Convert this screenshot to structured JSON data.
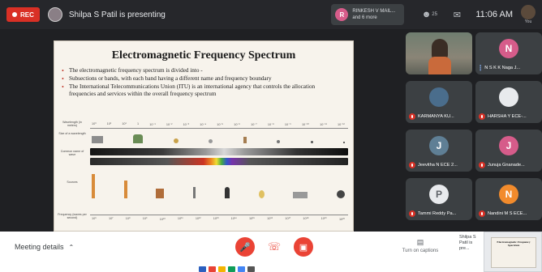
{
  "topbar": {
    "rec_label": "REC",
    "presenter_text": "Shilpa S Patil is presenting",
    "speaker": {
      "initial": "R",
      "name": "RINKESH V MAIL...",
      "subtext": "and 6 more"
    },
    "participants_badge": "25",
    "time": "11:06 AM",
    "you_label": "You"
  },
  "slide": {
    "title": "Electromagnetic Frequency Spectrum",
    "bullets": [
      "The electromagnetic frequency spectrum is divided into -",
      "Subsections or bands, with each band having a different name and frequency boundary",
      "The International Telecommunications Union (ITU) is an international agency that controls the allocation frequencies and services within the overall frequency spectrum"
    ],
    "row_labels": [
      "Wavelength (in meters)",
      "Size of a wavelength",
      "Common name of wave",
      "Sources",
      "Frequency (waves per second)"
    ],
    "wavelength_ticks": [
      "10³",
      "10²",
      "10¹",
      "1",
      "10⁻¹",
      "10⁻²",
      "10⁻³",
      "10⁻⁴",
      "10⁻⁵",
      "10⁻⁶",
      "10⁻⁷",
      "10⁻⁸",
      "10⁻⁹",
      "10⁻¹⁰",
      "10⁻¹¹",
      "10⁻¹²"
    ],
    "frequency_ticks": [
      "10⁶",
      "10⁷",
      "10⁸",
      "10⁹",
      "10¹⁰",
      "10¹¹",
      "10¹²",
      "10¹³",
      "10¹⁴",
      "10¹⁵",
      "10¹⁶",
      "10¹⁷",
      "10¹⁸",
      "10¹⁹",
      "10²⁰"
    ]
  },
  "tiles": [
    {
      "kind": "video",
      "name": ""
    },
    {
      "kind": "avatar",
      "initial": "N",
      "color": "#d65c8a",
      "name": "N S K K Naga J...",
      "mic": "on"
    },
    {
      "kind": "photo",
      "initial": "",
      "color": "#4a6d8c",
      "name": "KARMANYA KU...",
      "mic": "off"
    },
    {
      "kind": "photo",
      "initial": "",
      "color": "#e8eaed",
      "name": "HARSHA Y ECE-...",
      "mic": "off"
    },
    {
      "kind": "avatar",
      "initial": "J",
      "color": "#5f7f95",
      "name": "Jeevitha N ECE 2...",
      "mic": "off"
    },
    {
      "kind": "avatar",
      "initial": "J",
      "color": "#d65c8a",
      "name": "Junuja Gnanade...",
      "mic": "off"
    },
    {
      "kind": "avatar",
      "initial": "P",
      "color": "#e8eaed",
      "name": "Tammi Reddy Pa...",
      "mic": "off"
    },
    {
      "kind": "avatar",
      "initial": "N",
      "color": "#f28b2c",
      "name": "Nandini M S ECE...",
      "mic": "off"
    }
  ],
  "bottombar": {
    "meeting_details": "Meeting details",
    "captions_label": "Turn on captions",
    "present_label": "Shilpa S Patil is pre..."
  },
  "colors": {
    "accent_red": "#ea4335",
    "mic_off": "#d93025",
    "topbar": "#26272b"
  }
}
